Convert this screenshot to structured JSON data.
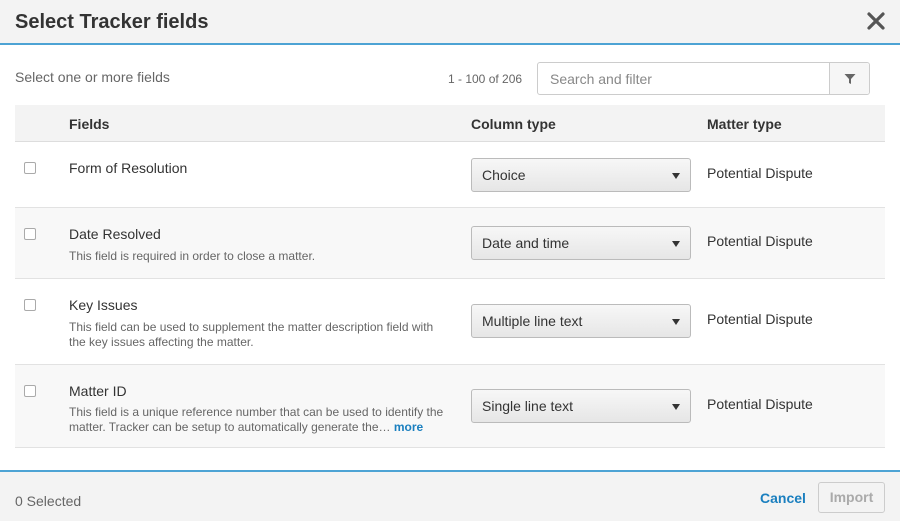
{
  "dialog": {
    "title": "Select Tracker fields"
  },
  "subtitle": "Select one or more fields",
  "pagination": "1 - 100 of 206",
  "search": {
    "placeholder": "Search and filter",
    "value": ""
  },
  "columns": {
    "fields": "Fields",
    "column_type": "Column type",
    "matter_type": "Matter type"
  },
  "rows": [
    {
      "name": "Form of Resolution",
      "description": "",
      "column_type": "Choice",
      "matter_type": "Potential Dispute"
    },
    {
      "name": "Date Resolved",
      "description": "This field is required in order to close a matter.",
      "column_type": "Date and time",
      "matter_type": "Potential Dispute"
    },
    {
      "name": "Key Issues",
      "description": "This field can be used to supplement the matter description field with the key issues affecting the matter.",
      "column_type": "Multiple line text",
      "matter_type": "Potential Dispute"
    },
    {
      "name": "Matter ID",
      "description": "This field is a unique reference number that can be used to identify the matter. Tracker can be setup to automatically generate the…",
      "more": "more",
      "column_type": "Single line text",
      "matter_type": "Potential Dispute"
    }
  ],
  "footer": {
    "selected": "0 Selected",
    "cancel": "Cancel",
    "import": "Import"
  },
  "colors": {
    "accent": "#4da3d4",
    "link": "#1a7fbf"
  },
  "icons": {
    "close": "close-icon",
    "filter": "filter-icon"
  }
}
